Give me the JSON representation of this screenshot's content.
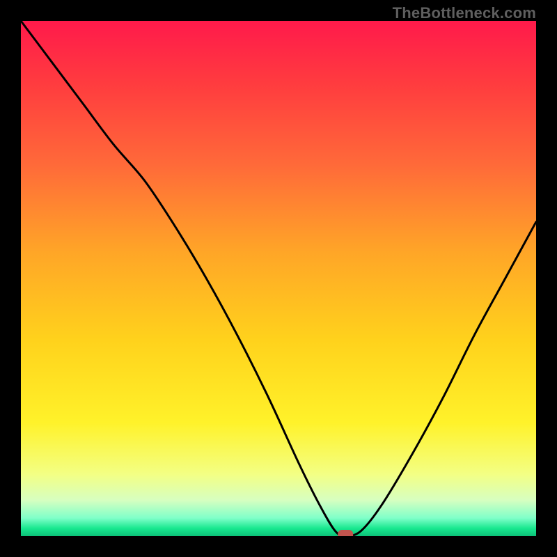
{
  "watermark": "TheBottleneck.com",
  "chart_data": {
    "type": "line",
    "title": "",
    "xlabel": "",
    "ylabel": "",
    "xlim": [
      0,
      100
    ],
    "ylim": [
      0,
      100
    ],
    "series": [
      {
        "name": "curve",
        "x": [
          0,
          6,
          12,
          18,
          24,
          30,
          36,
          42,
          48,
          54,
          58,
          61,
          63,
          66,
          70,
          76,
          82,
          88,
          94,
          100
        ],
        "y": [
          100,
          92,
          84,
          76,
          69,
          60,
          50,
          39,
          27,
          14,
          6,
          1,
          0,
          1,
          6,
          16,
          27,
          39,
          50,
          61
        ]
      }
    ],
    "marker": {
      "x": 63,
      "y": 0
    },
    "gradient_stops": [
      {
        "offset": 0.0,
        "color": "#ff1a4b"
      },
      {
        "offset": 0.12,
        "color": "#ff3b3f"
      },
      {
        "offset": 0.28,
        "color": "#ff6a39"
      },
      {
        "offset": 0.45,
        "color": "#ffa627"
      },
      {
        "offset": 0.62,
        "color": "#ffd21c"
      },
      {
        "offset": 0.78,
        "color": "#fff22a"
      },
      {
        "offset": 0.88,
        "color": "#f3ff84"
      },
      {
        "offset": 0.93,
        "color": "#d7ffc0"
      },
      {
        "offset": 0.965,
        "color": "#7fffc9"
      },
      {
        "offset": 0.985,
        "color": "#18e88f"
      },
      {
        "offset": 1.0,
        "color": "#0cc178"
      }
    ]
  }
}
